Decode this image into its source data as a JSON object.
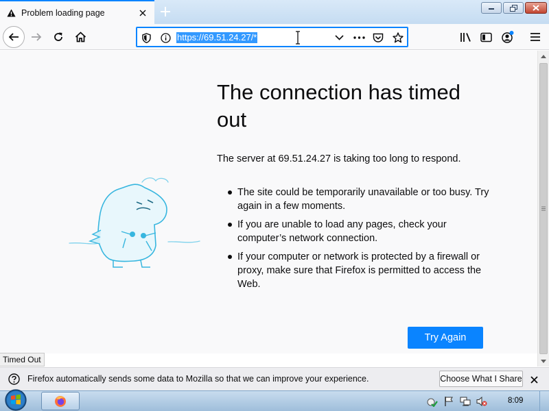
{
  "tab": {
    "title": "Problem loading page",
    "icon": "warning-icon"
  },
  "window_controls": {
    "minimize": "minimize-icon",
    "maximize": "maximize-icon",
    "close": "close-icon"
  },
  "url": {
    "value": "https://69.51.24.27/*"
  },
  "error": {
    "title": "The connection has timed out",
    "description": "The server at 69.51.24.27 is taking too long to respond.",
    "suggestions": [
      "The site could be temporarily unavailable or too busy. Try again in a few moments.",
      "If you are unable to load any pages, check your computer’s network connection.",
      "If your computer or network is protected by a firewall or proxy, make sure that Firefox is permitted to access the Web."
    ],
    "button": "Try Again"
  },
  "status": "Timed Out",
  "notification": {
    "text": "Firefox automatically sends some data to Mozilla so that we can improve your experience.",
    "button": "Choose What I Share"
  },
  "taskbar": {
    "clock": "8:09"
  },
  "colors": {
    "accent": "#0a84ff",
    "selection": "#3399ff",
    "page_bg": "#f9f9fa"
  }
}
